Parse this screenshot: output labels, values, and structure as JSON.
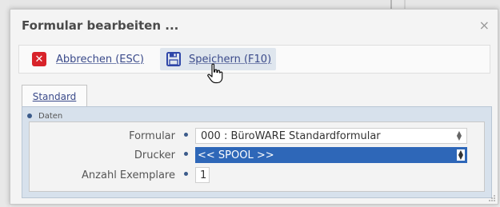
{
  "dialog": {
    "title": "Formular bearbeiten ...",
    "close_symbol": "×"
  },
  "toolbar": {
    "cancel_label": "Abbrechen (ESC)",
    "cancel_icon": "cancel-icon",
    "save_label": "Speichern (F10)",
    "save_icon": "floppy-disk-icon"
  },
  "tabs": [
    {
      "label": "Standard",
      "active": true
    }
  ],
  "panel": {
    "title": "Daten",
    "fields": [
      {
        "label": "Formular",
        "value": "000  : BüroWARE Standardformular",
        "type": "select"
      },
      {
        "label": "Drucker",
        "value": "<< SPOOL >>",
        "type": "select",
        "selected": true
      },
      {
        "label": "Anzahl Exemplare",
        "value": "1",
        "type": "number"
      }
    ]
  },
  "colors": {
    "accent": "#2e67b8",
    "cancel_red": "#d8232a",
    "link_blue": "#3a4a8a"
  }
}
